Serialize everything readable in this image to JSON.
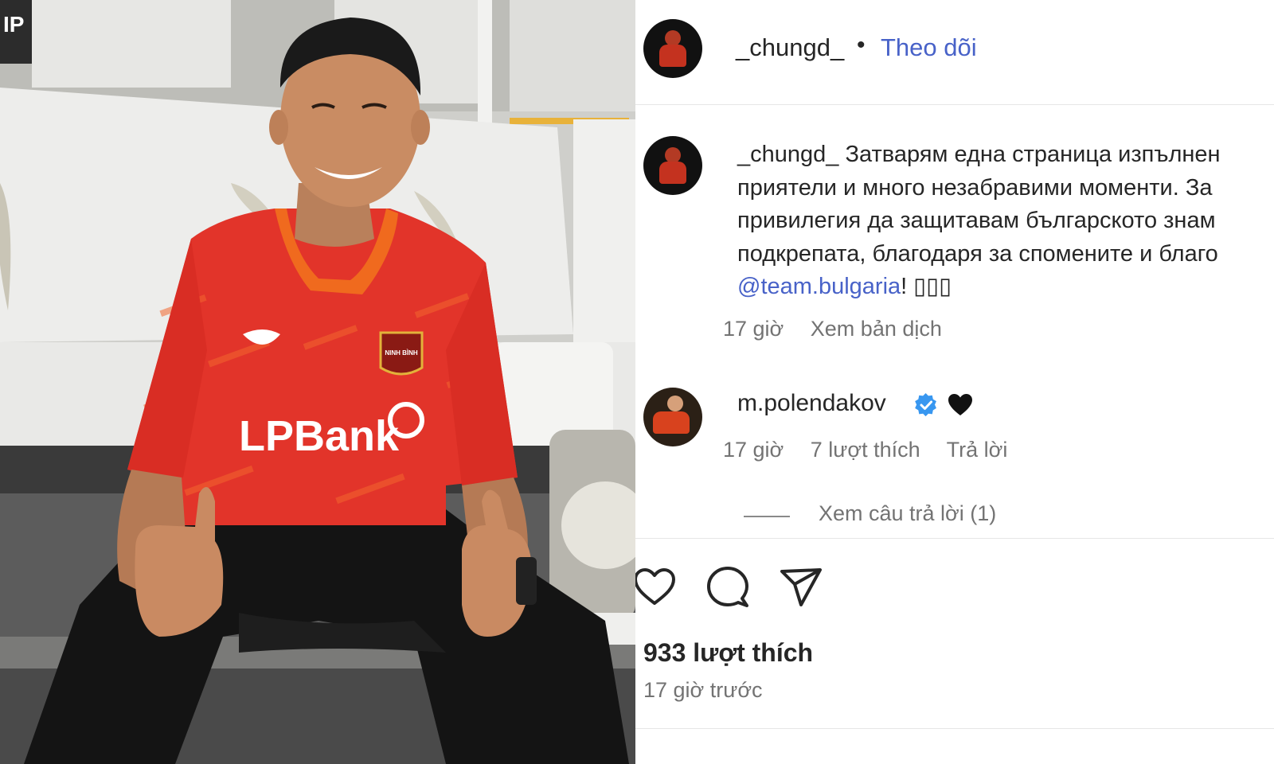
{
  "post": {
    "header": {
      "username": "_chungd_",
      "separator": "•",
      "follow_label": "Theo dõi"
    },
    "caption": {
      "username": "_chungd_",
      "lines": [
        "Затварям една страница изпълнен",
        "приятели и много незабравими моменти. За",
        "привилегия да защитавам българското знам",
        "подкрепата, благодаря за спомените и благо"
      ],
      "mention": "@team.bulgaria",
      "suffix": "! ▯▯▯",
      "time": "17 giờ",
      "translate_label": "Xem bản dịch"
    },
    "comment": {
      "username": "m.polendakov",
      "verified": true,
      "emoji_icon": "black-heart",
      "time": "17 giờ",
      "likes_label": "7 lượt thích",
      "reply_label": "Trả lời",
      "view_replies_label": "Xem câu trả lời (1)"
    },
    "actions": {
      "icons": [
        "heart-icon",
        "comment-icon",
        "share-icon"
      ]
    },
    "likes_count_label": "933 lượt thích",
    "posted_time_label": "17 giờ trước"
  },
  "photo": {
    "shirt_sponsor": "LPBank",
    "badge_text": "NINH BÌNH",
    "corner_text": "IP"
  },
  "colors": {
    "link": "#4862c8",
    "text": "#262626",
    "muted": "#737373",
    "jersey": "#e2342a",
    "verified": "#3897f0"
  }
}
